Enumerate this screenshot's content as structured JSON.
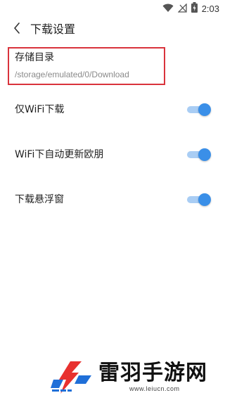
{
  "status_bar": {
    "time": "2:03",
    "icons": [
      "wifi-icon",
      "signal-off-icon",
      "battery-charging-icon"
    ]
  },
  "header": {
    "title": "下载设置",
    "back_icon": "chevron-left-icon"
  },
  "storage": {
    "title": "存储目录",
    "path": "/storage/emulated/0/Download",
    "highlight_color": "#d9333c"
  },
  "settings": [
    {
      "label": "仅WiFi下载",
      "enabled": true
    },
    {
      "label": "WiFi下自动更新欧朋",
      "enabled": true
    },
    {
      "label": "下载悬浮窗",
      "enabled": true
    }
  ],
  "colors": {
    "toggle_on": "#3a8fe8",
    "toggle_track": "#a9cdf4"
  },
  "watermark": {
    "brand": "雷羽手游网",
    "url": "www.leiucn.com"
  }
}
